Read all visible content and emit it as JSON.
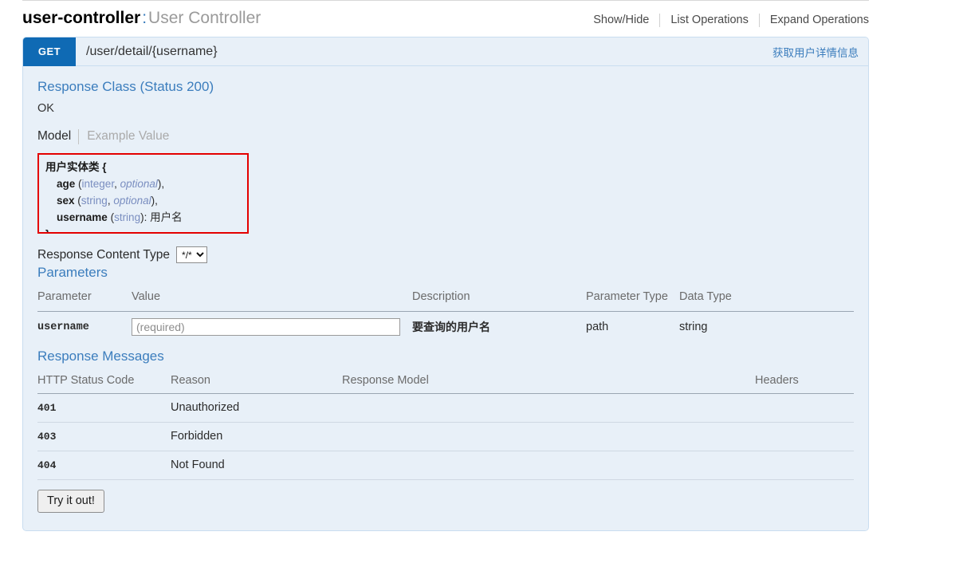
{
  "resource": {
    "name": "user-controller",
    "separator": ":",
    "description": "User Controller",
    "operations": [
      {
        "label": "Show/Hide"
      },
      {
        "label": "List Operations"
      },
      {
        "label": "Expand Operations"
      }
    ]
  },
  "operation": {
    "method": "GET",
    "path": "/user/detail/{username}",
    "summary": "获取用户详情信息"
  },
  "response_class": {
    "heading": "Response Class (Status 200)",
    "status_text": "OK",
    "tabs": [
      {
        "label": "Model",
        "active": true
      },
      {
        "label": "Example Value",
        "active": false
      }
    ],
    "model": {
      "class_name": "用户实体类",
      "open_brace": "{",
      "close_brace": "}",
      "properties": [
        {
          "name": "age",
          "type": "integer",
          "optional": "optional",
          "comma": ",",
          "description": ""
        },
        {
          "name": "sex",
          "type": "string",
          "optional": "optional",
          "comma": ",",
          "description": ""
        },
        {
          "name": "username",
          "type": "string",
          "optional": "",
          "comma": "",
          "description": "用户名"
        }
      ],
      "highlight_color": "#e40000"
    }
  },
  "response_content_type": {
    "label": "Response Content Type",
    "selected": "*/*",
    "options": [
      "*/*"
    ]
  },
  "parameters": {
    "heading": "Parameters",
    "columns": [
      "Parameter",
      "Value",
      "Description",
      "Parameter Type",
      "Data Type"
    ],
    "rows": [
      {
        "parameter": "username",
        "value": "",
        "value_placeholder": "(required)",
        "description": "要查询的用户名",
        "parameter_type": "path",
        "data_type": "string"
      }
    ]
  },
  "response_messages": {
    "heading": "Response Messages",
    "columns": [
      "HTTP Status Code",
      "Reason",
      "Response Model",
      "Headers"
    ],
    "rows": [
      {
        "code": "401",
        "reason": "Unauthorized",
        "model": "",
        "headers": ""
      },
      {
        "code": "403",
        "reason": "Forbidden",
        "model": "",
        "headers": ""
      },
      {
        "code": "404",
        "reason": "Not Found",
        "model": "",
        "headers": ""
      }
    ]
  },
  "actions": {
    "try_it_out": "Try it out!"
  },
  "colors": {
    "method_get": "#0f6ab4",
    "panel_background": "#e8f0f8",
    "panel_border": "#c9ddf0",
    "link_blue": "#3b7dbd",
    "highlight_red": "#e40000"
  }
}
